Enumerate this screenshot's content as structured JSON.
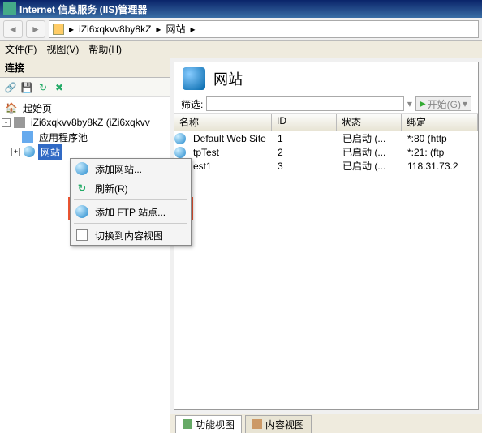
{
  "window": {
    "title": "Internet 信息服务 (IIS)管理器"
  },
  "nav": {
    "back": "◄",
    "fwd": "►",
    "crumb1": "iZi6xqkvv8by8kZ",
    "crumb2": "网站",
    "sep": "▸"
  },
  "menubar": {
    "file": "文件(F)",
    "view": "视图(V)",
    "help": "帮助(H)"
  },
  "left": {
    "title": "连接",
    "tree": {
      "start": "起始页",
      "server": "iZi6xqkvv8by8kZ (iZi6xqkvv",
      "apppool": "应用程序池",
      "sites": "网站"
    }
  },
  "context": {
    "add_site": "添加网站...",
    "refresh": "刷新(R)",
    "add_ftp": "添加 FTP 站点...",
    "content_view": "切换到内容视图"
  },
  "right": {
    "title": "网站",
    "filter_label": "筛选:",
    "start_btn": "开始(G)",
    "columns": {
      "name": "名称",
      "id": "ID",
      "status": "状态",
      "bind": "绑定"
    },
    "rows": [
      {
        "name": "Default Web Site",
        "id": "1",
        "status": "已启动 (...",
        "bind": "*:80 (http"
      },
      {
        "name": "tpTest",
        "id": "2",
        "status": "已启动 (...",
        "bind": "*:21: (ftp"
      },
      {
        "name": "est1",
        "id": "3",
        "status": "已启动 (...",
        "bind": "118.31.73.2"
      }
    ]
  },
  "tabs": {
    "features": "功能视图",
    "content": "内容视图"
  }
}
